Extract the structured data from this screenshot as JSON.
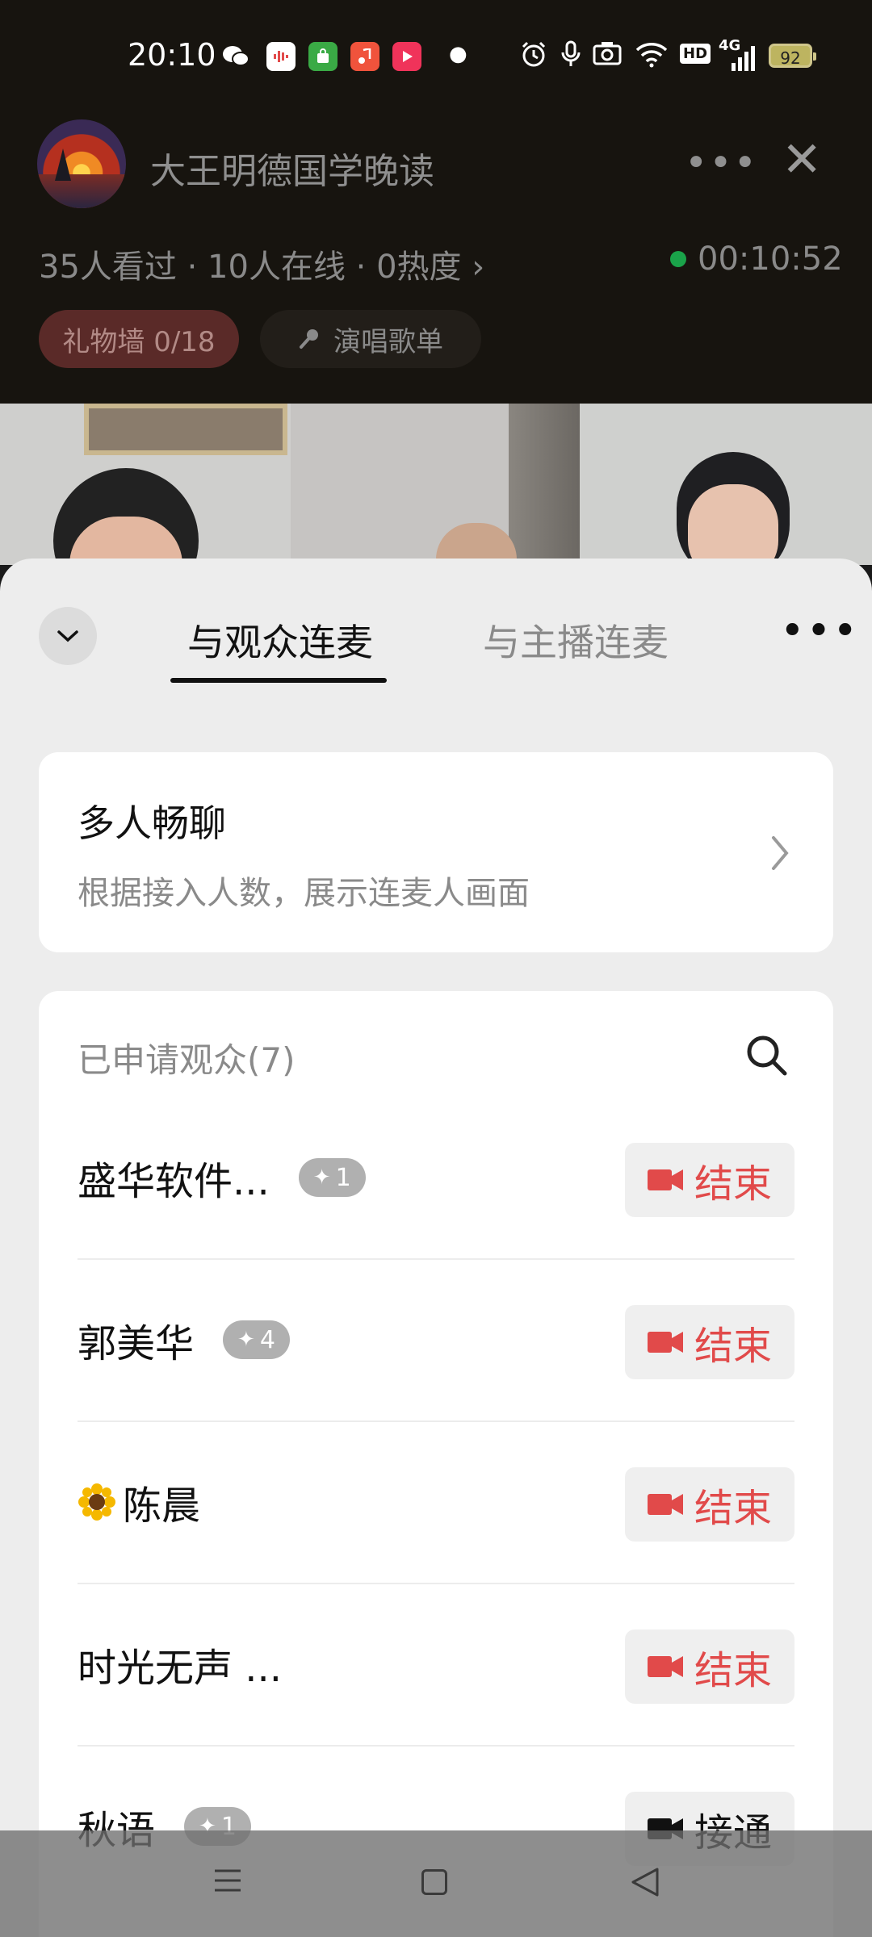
{
  "status_bar": {
    "time": "20:10",
    "battery": "92",
    "network": "4G",
    "hd": "HD",
    "icons": [
      "wechat-icon",
      "audio-app-icon",
      "shopping-bag-icon",
      "music-icon",
      "video-play-icon",
      "dot-icon",
      "alarm-icon",
      "mic-icon",
      "camera-icon",
      "wifi-icon",
      "hd-icon",
      "signal-icon",
      "battery-icon"
    ]
  },
  "live_header": {
    "title": "大王明德国学晚读",
    "stats": "35人看过 · 10人在线 · 0热度 ›",
    "timer": "00:10:52",
    "gift_wall": "礼物墙 0/18",
    "song_list": "演唱歌单"
  },
  "sheet": {
    "tabs": [
      {
        "label": "与观众连麦",
        "active": true
      },
      {
        "label": "与主播连麦",
        "active": false
      }
    ],
    "mode_card": {
      "title": "多人畅聊",
      "subtitle": "根据接入人数，展示连麦人画面"
    },
    "applicants_header": "已申请观众(7)",
    "applicants": [
      {
        "name": "盛华软件...",
        "badge": "1",
        "action": "结束",
        "state": "end"
      },
      {
        "name": "郭美华",
        "badge": "4",
        "action": "结束",
        "state": "end"
      },
      {
        "name": "陈晨",
        "emoji": "sunflower",
        "action": "结束",
        "state": "end"
      },
      {
        "name": "时光无声 ...",
        "action": "结束",
        "state": "end"
      },
      {
        "name": "秋语",
        "badge": "1",
        "action": "接通",
        "state": "accept"
      }
    ]
  },
  "colors": {
    "accent_red": "#e14a4a",
    "live_green": "#1aa34a",
    "sheet_bg": "#ededed"
  }
}
